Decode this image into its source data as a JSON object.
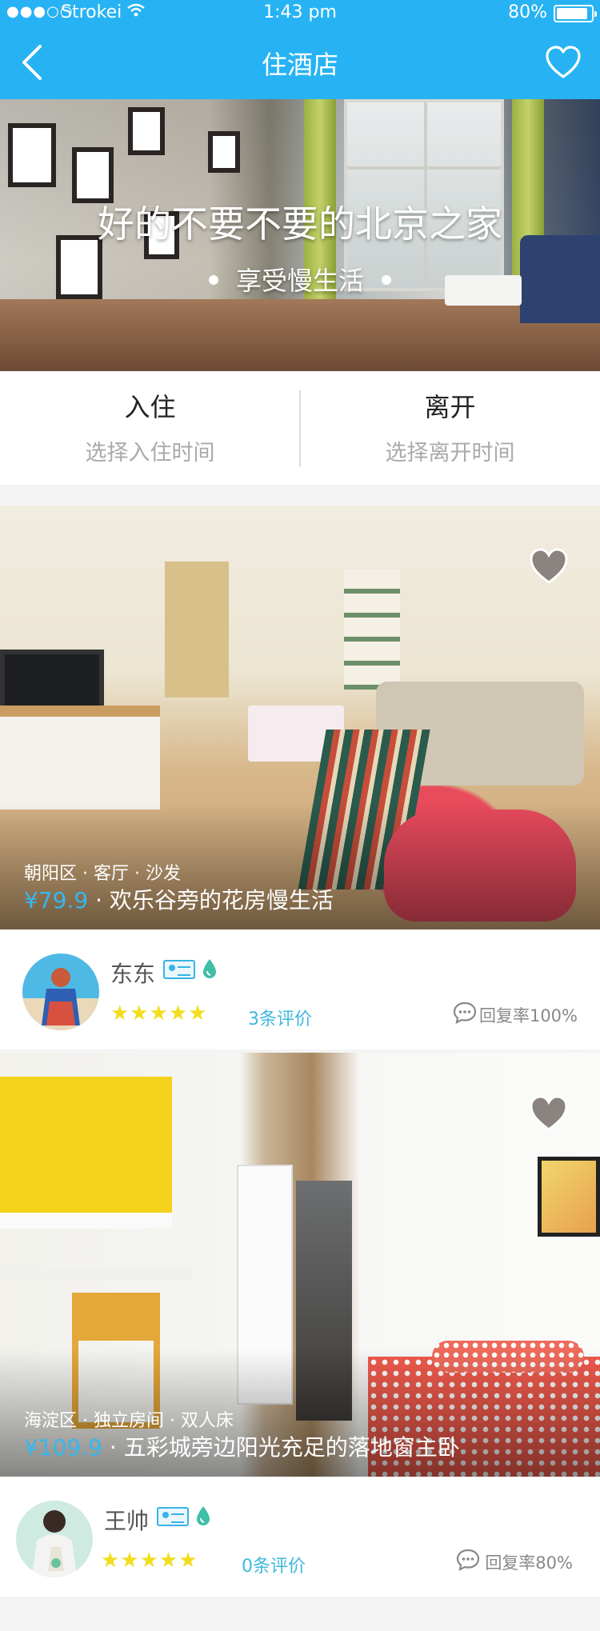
{
  "status_bar": {
    "signal": "●●●○○",
    "carrier": "Strokei",
    "time": "1:43 pm",
    "battery": "80%"
  },
  "nav": {
    "title": "住酒店",
    "back_icon": "chevron-left-icon",
    "fav_icon": "heart-outline-icon"
  },
  "hero": {
    "title": "好的不要不要的北京之家",
    "subtitle": "享受慢生活"
  },
  "dates": {
    "checkin_label": "入住",
    "checkin_hint": "选择入住时间",
    "checkout_label": "离开",
    "checkout_hint": "选择离开时间"
  },
  "listings": [
    {
      "meta": "朝阳区 · 客厅 · 沙发",
      "price": "¥79.9",
      "sep": " · ",
      "name": "欢乐谷旁的花房慢生活",
      "host": "东东",
      "stars": "★★★★★",
      "reviews": "3条评价",
      "reply_rate": "回复率100%"
    },
    {
      "meta": "海淀区 · 独立房间 · 双人床",
      "price": "¥109.9",
      "sep": " · ",
      "name": "五彩城旁边阳光充足的落地窗主卧",
      "host": "王帅",
      "stars": "★★★★★",
      "reviews": "0条评价",
      "reply_rate": "回复率80%"
    }
  ],
  "colors": {
    "brand": "#27b3f3",
    "price": "#34b8ef",
    "stars": "#f2dd1e",
    "reviews": "#3db8dc"
  }
}
